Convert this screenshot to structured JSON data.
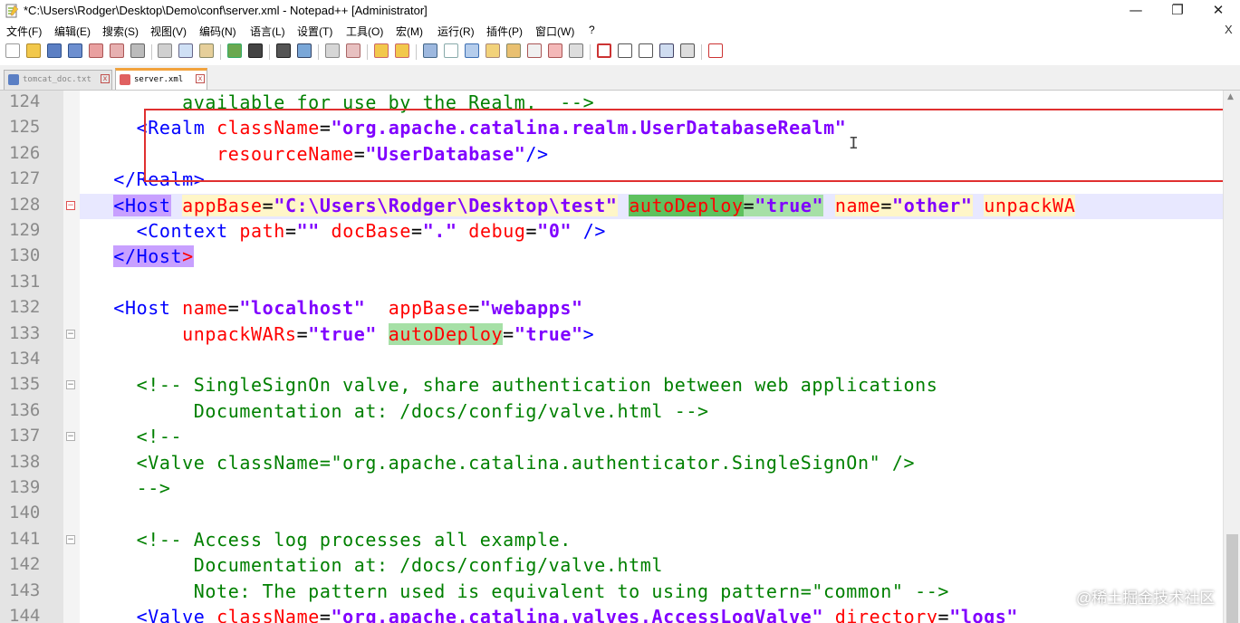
{
  "window": {
    "title": "*C:\\Users\\Rodger\\Desktop\\Demo\\conf\\server.xml - Notepad++ [Administrator]",
    "minimize": "—",
    "maximize": "❐",
    "close": "✕"
  },
  "menu": {
    "items": [
      "文件(F)",
      "编辑(E)",
      "搜索(S)",
      "视图(V)",
      "编码(N)",
      "语言(L)",
      "设置(T)",
      "工具(O)",
      "宏(M)",
      "运行(R)",
      "插件(P)",
      "窗口(W)",
      "?"
    ],
    "close_x": "X"
  },
  "tabs": [
    {
      "label": "tomcat_doc.txt",
      "active": false
    },
    {
      "label": "server.xml",
      "active": true
    }
  ],
  "editor": {
    "lines": [
      {
        "n": "124",
        "fold": "",
        "segs": [
          [
            "c-com",
            "        available for use by the Realm.  -->"
          ]
        ]
      },
      {
        "n": "125",
        "fold": "",
        "segs": [
          [
            "c-sym",
            "    "
          ],
          [
            "c-tag",
            "<Realm "
          ],
          [
            "c-atr",
            "className"
          ],
          [
            "c-sym",
            "="
          ],
          [
            "c-val",
            "\"org.apache.catalina.realm.UserDatabaseRealm\""
          ]
        ]
      },
      {
        "n": "126",
        "fold": "",
        "segs": [
          [
            "c-sym",
            "           "
          ],
          [
            "c-atr",
            "resourceName"
          ],
          [
            "c-sym",
            "="
          ],
          [
            "c-val",
            "\"UserDatabase\""
          ],
          [
            "c-tag",
            "/>"
          ]
        ]
      },
      {
        "n": "127",
        "fold": "",
        "segs": [
          [
            "c-sym",
            "  "
          ],
          [
            "c-tag",
            "</Realm>"
          ]
        ]
      },
      {
        "n": "128",
        "fold": "minus-red",
        "highlight": true,
        "segs": [
          [
            "c-sym",
            "  "
          ],
          [
            "c-tag hl-tag",
            "<Host"
          ],
          [
            "c-sym",
            " "
          ],
          [
            "c-atr hl-yellow",
            "appBase"
          ],
          [
            "c-sym hl-yellow",
            "="
          ],
          [
            "c-val hl-yellow",
            "\"C:\\Users\\Rodger\\Desktop\\test\""
          ],
          [
            "c-sym",
            " "
          ],
          [
            "c-atr hl-green-dark",
            "autoDeploy"
          ],
          [
            "c-sym hl-green",
            "="
          ],
          [
            "c-val hl-green",
            "\"true\""
          ],
          [
            "c-sym",
            " "
          ],
          [
            "c-atr hl-yellow",
            "name"
          ],
          [
            "c-sym hl-yellow",
            "="
          ],
          [
            "c-val hl-yellow",
            "\"other\""
          ],
          [
            "c-sym",
            " "
          ],
          [
            "c-atr hl-yellow",
            "unpackWA"
          ]
        ]
      },
      {
        "n": "129",
        "fold": "",
        "segs": [
          [
            "c-sym",
            "    "
          ],
          [
            "c-tag",
            "<Context "
          ],
          [
            "c-atr",
            "path"
          ],
          [
            "c-sym",
            "="
          ],
          [
            "c-val",
            "\"\""
          ],
          [
            "c-sym",
            " "
          ],
          [
            "c-atr",
            "docBase"
          ],
          [
            "c-sym",
            "="
          ],
          [
            "c-val",
            "\".\""
          ],
          [
            "c-sym",
            " "
          ],
          [
            "c-atr",
            "debug"
          ],
          [
            "c-sym",
            "="
          ],
          [
            "c-val",
            "\"0\""
          ],
          [
            "c-sym",
            " "
          ],
          [
            "c-tag",
            "/>"
          ]
        ]
      },
      {
        "n": "130",
        "fold": "",
        "segs": [
          [
            "c-sym",
            "  "
          ],
          [
            "c-tag hl-tag",
            "</Host"
          ],
          [
            "c-atr hl-tag",
            ">"
          ]
        ]
      },
      {
        "n": "131",
        "fold": "",
        "segs": [
          [
            "c-sym",
            ""
          ]
        ]
      },
      {
        "n": "132",
        "fold": "",
        "segs": [
          [
            "c-sym",
            "  "
          ],
          [
            "c-tag",
            "<Host "
          ],
          [
            "c-atr",
            "name"
          ],
          [
            "c-sym",
            "="
          ],
          [
            "c-val",
            "\"localhost\""
          ],
          [
            "c-sym",
            "  "
          ],
          [
            "c-atr",
            "appBase"
          ],
          [
            "c-sym",
            "="
          ],
          [
            "c-val",
            "\"webapps\""
          ]
        ]
      },
      {
        "n": "133",
        "fold": "minus",
        "segs": [
          [
            "c-sym",
            "        "
          ],
          [
            "c-atr",
            "unpackWARs"
          ],
          [
            "c-sym",
            "="
          ],
          [
            "c-val",
            "\"true\""
          ],
          [
            "c-sym",
            " "
          ],
          [
            "c-atr hl-green",
            "autoDeploy"
          ],
          [
            "c-sym",
            "="
          ],
          [
            "c-val",
            "\"true\""
          ],
          [
            "c-tag",
            ">"
          ]
        ]
      },
      {
        "n": "134",
        "fold": "",
        "segs": [
          [
            "c-sym",
            ""
          ]
        ]
      },
      {
        "n": "135",
        "fold": "minus",
        "segs": [
          [
            "c-sym",
            "    "
          ],
          [
            "c-com",
            "<!-- SingleSignOn valve, share authentication between web applications"
          ]
        ]
      },
      {
        "n": "136",
        "fold": "",
        "segs": [
          [
            "c-com",
            "         Documentation at: /docs/config/valve.html -->"
          ]
        ]
      },
      {
        "n": "137",
        "fold": "minus",
        "segs": [
          [
            "c-sym",
            "    "
          ],
          [
            "c-com",
            "<!--"
          ]
        ]
      },
      {
        "n": "138",
        "fold": "",
        "segs": [
          [
            "c-com",
            "    <Valve className=\"org.apache.catalina.authenticator.SingleSignOn\" />"
          ]
        ]
      },
      {
        "n": "139",
        "fold": "",
        "segs": [
          [
            "c-com",
            "    -->"
          ]
        ]
      },
      {
        "n": "140",
        "fold": "",
        "segs": [
          [
            "c-sym",
            ""
          ]
        ]
      },
      {
        "n": "141",
        "fold": "minus",
        "segs": [
          [
            "c-sym",
            "    "
          ],
          [
            "c-com",
            "<!-- Access log processes all example."
          ]
        ]
      },
      {
        "n": "142",
        "fold": "",
        "segs": [
          [
            "c-com",
            "         Documentation at: /docs/config/valve.html"
          ]
        ]
      },
      {
        "n": "143",
        "fold": "",
        "segs": [
          [
            "c-com",
            "         Note: The pattern used is equivalent to using pattern=\"common\" -->"
          ]
        ]
      },
      {
        "n": "144",
        "fold": "",
        "segs": [
          [
            "c-sym",
            "    "
          ],
          [
            "c-tag",
            "<Valve "
          ],
          [
            "c-atr",
            "className"
          ],
          [
            "c-sym",
            "="
          ],
          [
            "c-val",
            "\"org.apache.catalina.valves.AccessLogValve\""
          ],
          [
            "c-sym",
            " "
          ],
          [
            "c-atr",
            "directory"
          ],
          [
            "c-sym",
            "="
          ],
          [
            "c-val",
            "\"logs\""
          ]
        ]
      }
    ],
    "cursor_glyph": "I"
  },
  "watermark": "@稀土掘金技术社区",
  "colors": {
    "comment": "#008000",
    "tag": "#0000ff",
    "attribute": "#ff0000",
    "value": "#8000ff",
    "selection_box": "#e03030",
    "active_tab_accent": "#f2a23c"
  }
}
